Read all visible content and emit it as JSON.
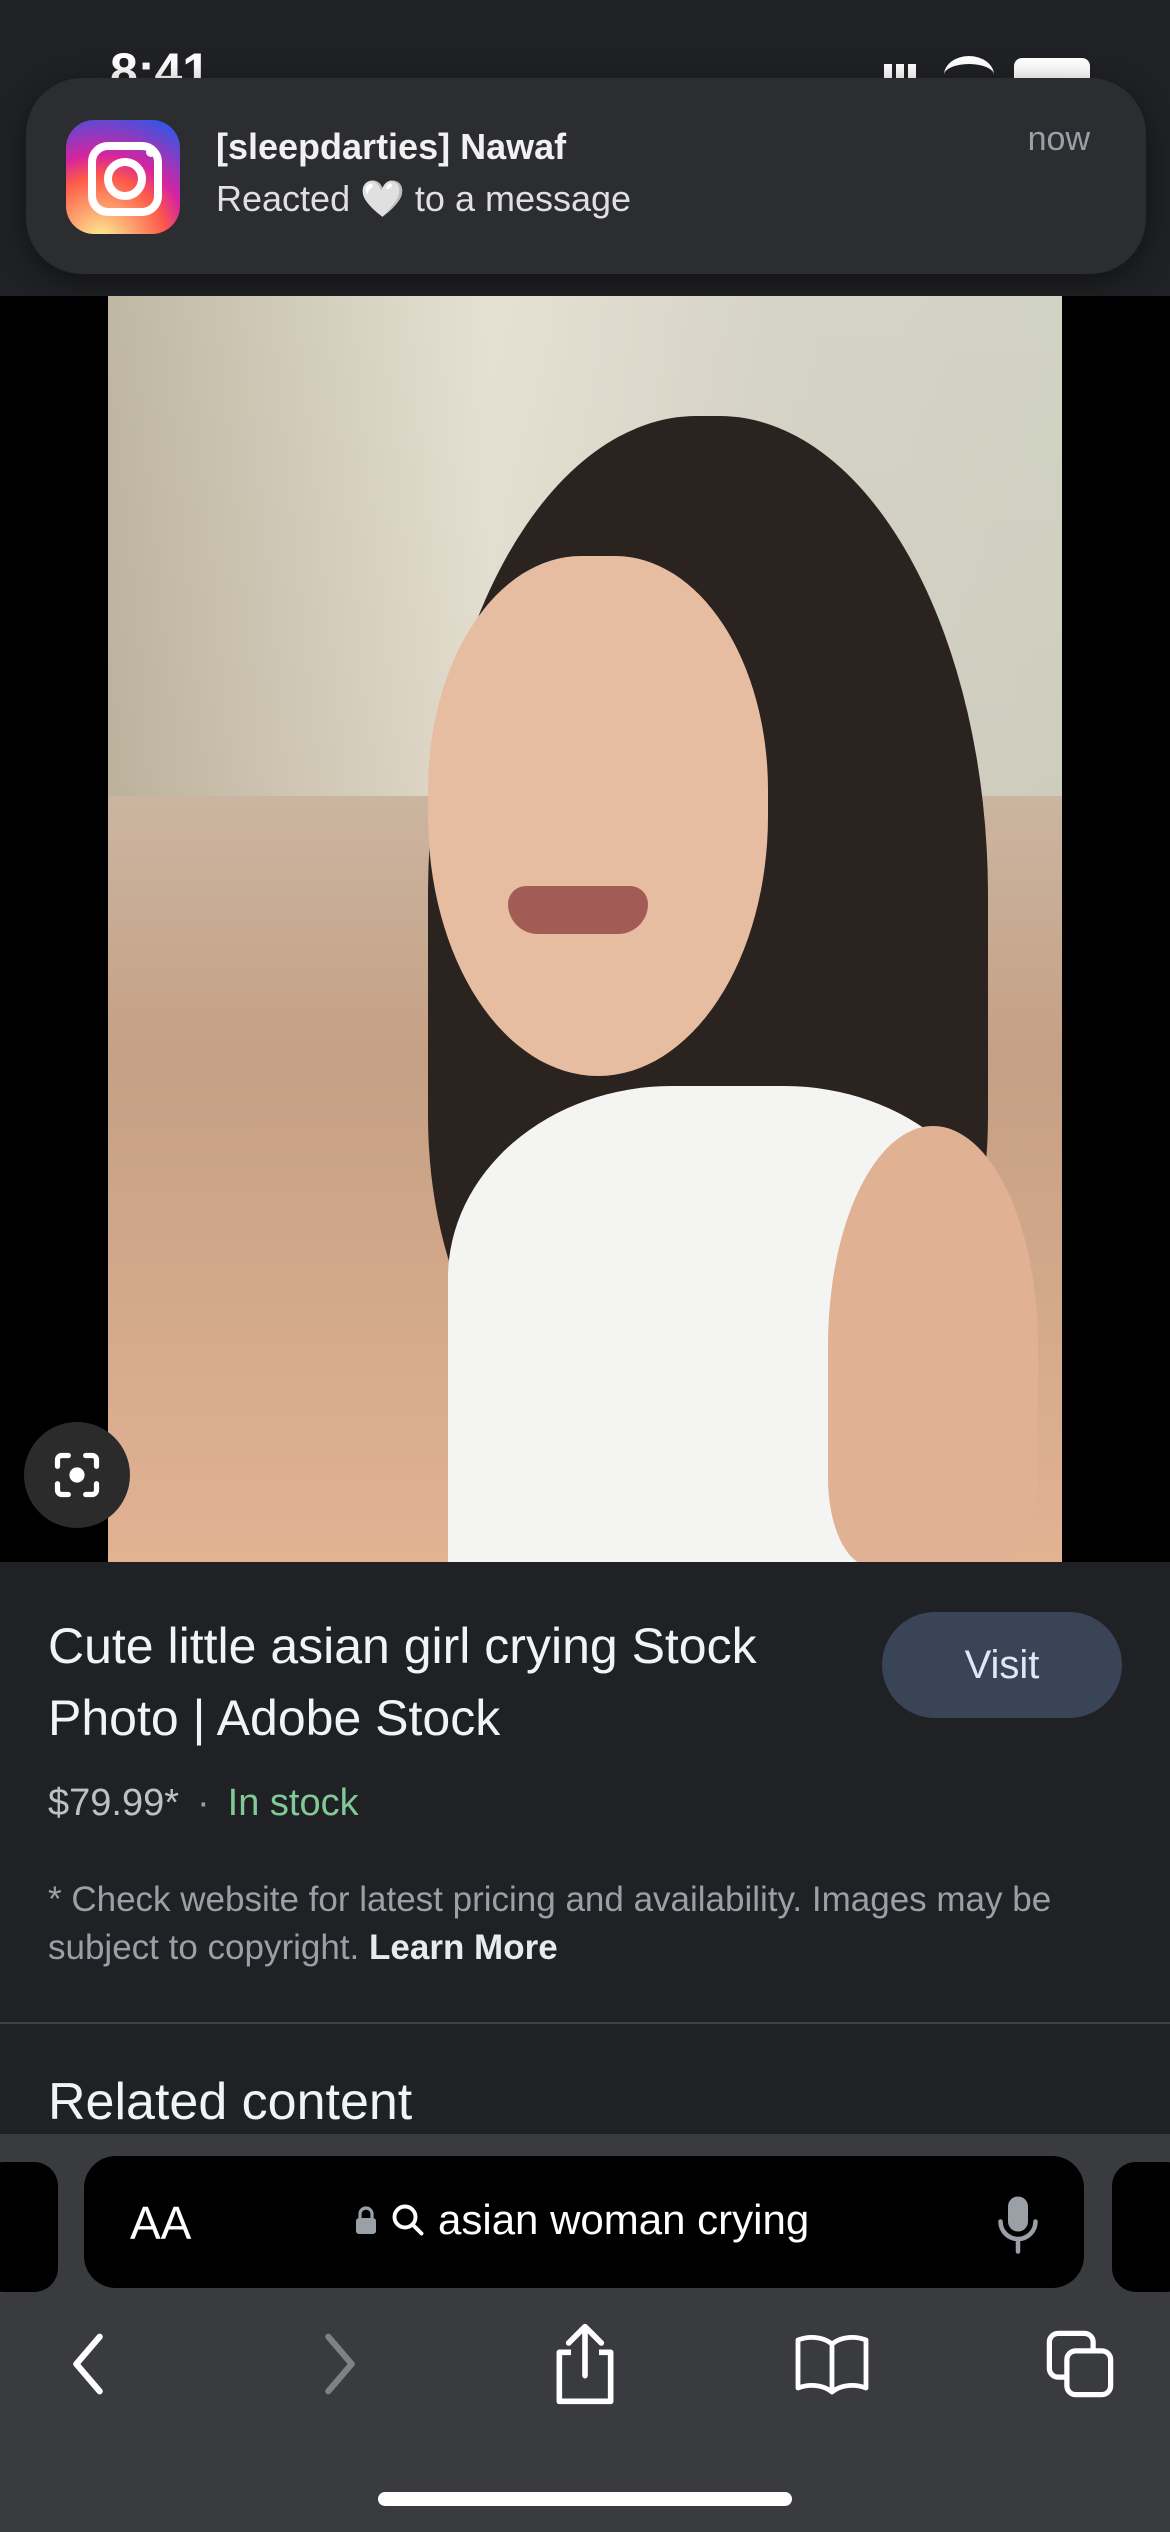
{
  "status_bar": {
    "time": "8:41"
  },
  "notification": {
    "app": "Instagram",
    "title": "[sleepdarties] Nawaf",
    "body": "Reacted 🤍 to a message",
    "time": "now"
  },
  "result": {
    "title": "Cute little asian girl crying Stock Photo | Adobe Stock",
    "visit_label": "Visit",
    "price": "$79.99*",
    "separator": "·",
    "stock": "In stock",
    "disclaimer": "* Check website for latest pricing and availability. Images may be subject to copyright.",
    "learn_more": "Learn More"
  },
  "related_heading": "Related content",
  "browser": {
    "aa_label": "AA",
    "search_text": "asian woman crying"
  },
  "colors": {
    "background": "#202124",
    "stock_green": "#81c995",
    "visit_button": "#394457"
  }
}
